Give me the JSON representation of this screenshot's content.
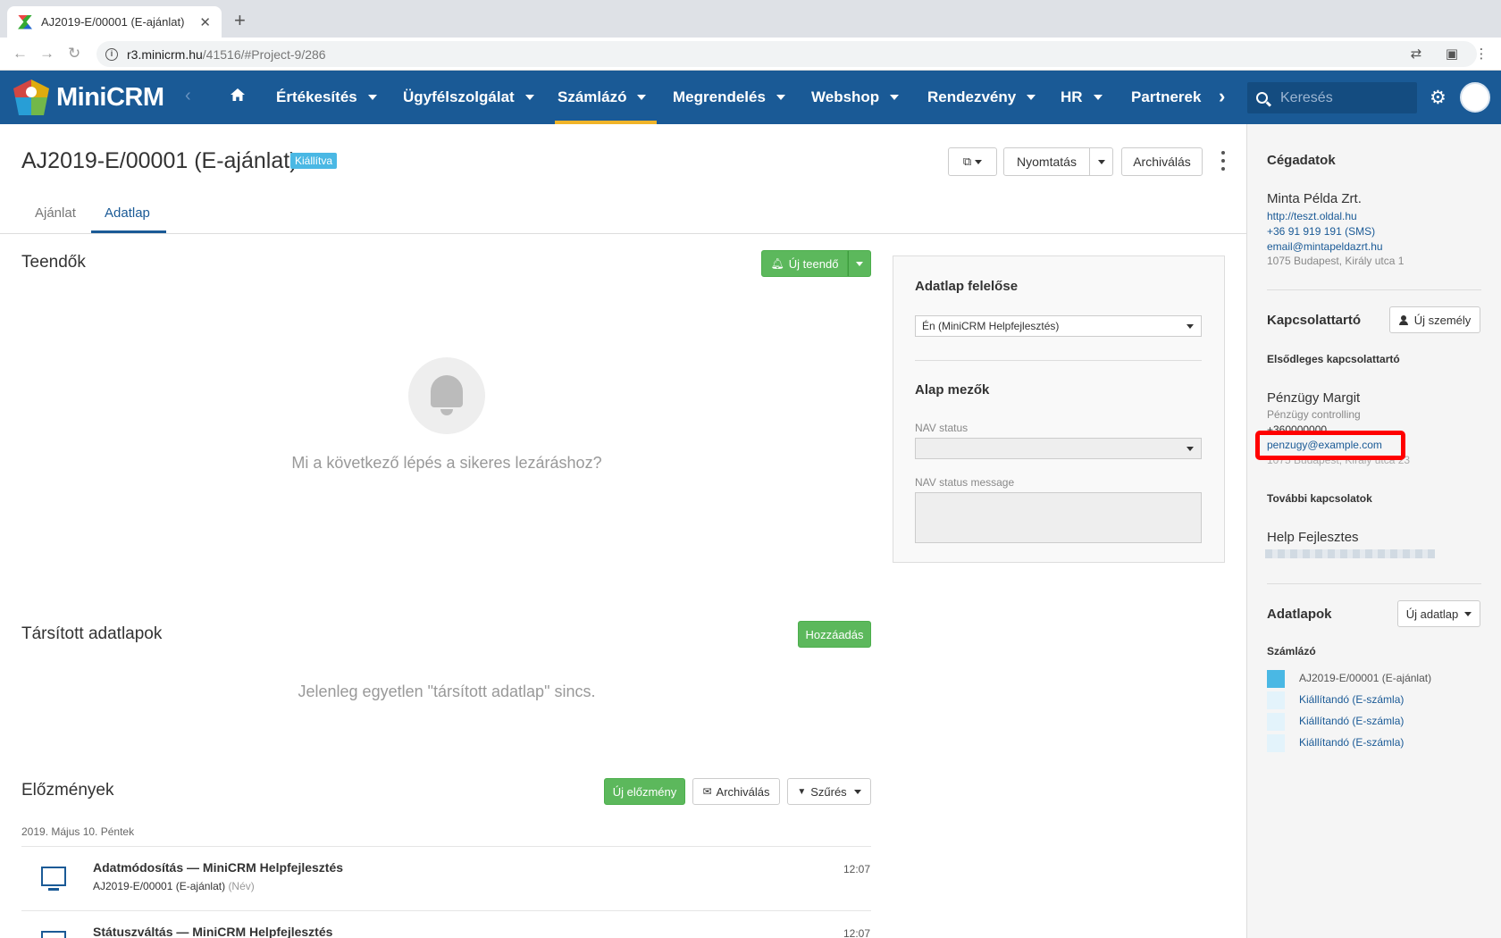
{
  "browser": {
    "tab_title": "AJ2019-E/00001 (E-ajánlat)",
    "url_host": "r3.minicrm.hu",
    "url_path": "/41516/#Project-9/286"
  },
  "app": {
    "brand": "MiniCRM",
    "nav": [
      "Értékesítés",
      "Ügyfélszolgálat",
      "Számlázó",
      "Megrendelés",
      "Webshop",
      "Rendezvény",
      "HR",
      "Partnerek"
    ],
    "active_nav": "Számlázó",
    "search_placeholder": "Keresés",
    "accent": "#1a5a96"
  },
  "page": {
    "title": "AJ2019-E/00001 (E-ajánlat)",
    "status": "Kiállítva",
    "buttons": {
      "print": "Nyomtatás",
      "archive": "Archiválás"
    },
    "tabs": [
      "Ajánlat",
      "Adatlap"
    ],
    "active_tab": "Adatlap"
  },
  "todos": {
    "title": "Teendők",
    "new_button": "Új teendő",
    "empty": "Mi a következő lépés a sikeres lezáráshoz?"
  },
  "linked": {
    "title": "Társított adatlapok",
    "add_button": "Hozzáadás",
    "empty": "Jelenleg egyetlen \"társított adatlap\" sincs."
  },
  "panel": {
    "owner_title": "Adatlap felelőse",
    "owner_value": "Én (MiniCRM Helpfejlesztés)",
    "basic_title": "Alap mezők",
    "nav_status_label": "NAV status",
    "nav_status_message_label": "NAV status message"
  },
  "history": {
    "title": "Előzmények",
    "new_button": "Új előzmény",
    "archive_button": "Archiválás",
    "filter_button": "Szűrés",
    "date": "2019. Május 10. Péntek",
    "entries": [
      {
        "title": "Adatmódosítás — MiniCRM Helpfejlesztés",
        "subtitle": "AJ2019-E/00001 (E-ajánlat)",
        "note": "(Név)",
        "time": "12:07"
      },
      {
        "title": "Státuszváltás — MiniCRM Helpfejlesztés",
        "time": "12:07"
      }
    ]
  },
  "sidebar": {
    "company_title": "Cégadatok",
    "company_name": "Minta Példa Zrt.",
    "company_web": "http://teszt.oldal.hu",
    "company_phone": "+36 91 919 191 (SMS)",
    "company_email": "email@mintapeldazrt.hu",
    "company_address": "1075 Budapest, Király utca 1",
    "contact_title": "Kapcsolattartó",
    "new_person_button": "Új személy",
    "primary_label": "Elsődleges kapcsolattartó",
    "contact_name": "Pénzügy Margit",
    "contact_role": "Pénzügy controlling",
    "contact_phone": "+360000000",
    "contact_email": "penzugy@example.com",
    "contact_address": "1075 Budapest, Király utca 23",
    "more_contacts_label": "További kapcsolatok",
    "more_contact_name": "Help Fejlesztes",
    "records_title": "Adatlapok",
    "new_record_button": "Új adatlap",
    "records_group": "Számlázó",
    "records": [
      "AJ2019-E/00001 (E-ajánlat)",
      "Kiállítandó (E-számla)",
      "Kiállítandó (E-számla)",
      "Kiállítandó (E-számla)"
    ]
  }
}
